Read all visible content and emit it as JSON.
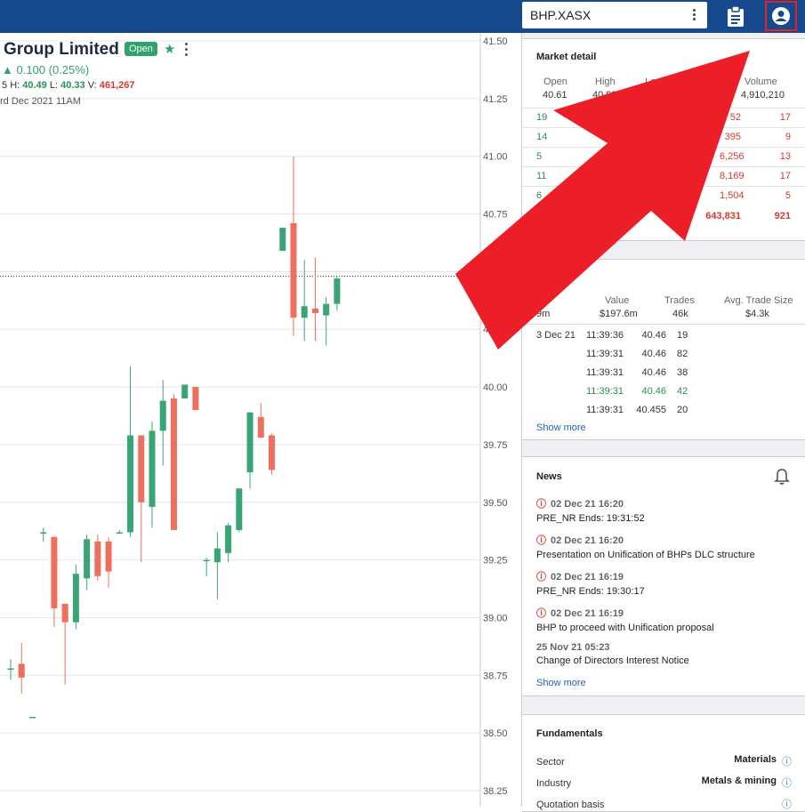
{
  "symbol_field": {
    "value": "BHP.XASX"
  },
  "stock": {
    "title": "Group Limited",
    "status": "Open",
    "change_text": "0.100 (0.25%)",
    "h_label": "H:",
    "high": "40.49",
    "l_label": "L:",
    "low": "40.33",
    "v_label": "V:",
    "volume": "461,267",
    "datetime": "rd Dec 2021 11AM",
    "prefix_digit": "5"
  },
  "chart_data": {
    "type": "candlestick",
    "y_ticks": [
      "41.50",
      "41.25",
      "41.00",
      "40.75",
      "40.50",
      "40.25",
      "40.00",
      "39.75",
      "39.50",
      "39.25",
      "39.00",
      "38.75",
      "38.50",
      "38.25"
    ],
    "ylim": [
      38.2,
      41.55
    ],
    "reference_line": 40.48,
    "candles": [
      {
        "o": 38.78,
        "h": 38.82,
        "l": 38.73,
        "c": 38.78
      },
      {
        "o": 38.8,
        "h": 38.89,
        "l": 38.67,
        "c": 38.74
      },
      {
        "o": 38.57,
        "h": 38.57,
        "l": 38.57,
        "c": 38.57
      },
      {
        "o": 39.37,
        "h": 39.39,
        "l": 39.33,
        "c": 39.37
      },
      {
        "o": 39.35,
        "h": 39.35,
        "l": 38.96,
        "c": 39.04
      },
      {
        "o": 39.06,
        "h": 39.06,
        "l": 38.71,
        "c": 38.98
      },
      {
        "o": 38.98,
        "h": 39.23,
        "l": 38.95,
        "c": 39.19
      },
      {
        "o": 39.17,
        "h": 39.36,
        "l": 39.12,
        "c": 39.34
      },
      {
        "o": 39.33,
        "h": 39.36,
        "l": 39.16,
        "c": 39.18
      },
      {
        "o": 39.33,
        "h": 39.35,
        "l": 39.13,
        "c": 39.2
      },
      {
        "o": 39.37,
        "h": 39.38,
        "l": 39.37,
        "c": 39.37
      },
      {
        "o": 39.37,
        "h": 40.09,
        "l": 39.35,
        "c": 39.79
      },
      {
        "o": 39.79,
        "h": 39.79,
        "l": 39.24,
        "c": 39.5
      },
      {
        "o": 39.48,
        "h": 39.85,
        "l": 39.39,
        "c": 39.81
      },
      {
        "o": 39.81,
        "h": 40.03,
        "l": 39.66,
        "c": 39.94
      },
      {
        "o": 39.95,
        "h": 39.97,
        "l": 39.38,
        "c": 39.38
      },
      {
        "o": 39.95,
        "h": 40.01,
        "l": 39.95,
        "c": 40.01
      },
      {
        "o": 40.0,
        "h": 40.0,
        "l": 39.9,
        "c": 39.9
      },
      {
        "o": 39.25,
        "h": 39.26,
        "l": 39.18,
        "c": 39.25
      },
      {
        "o": 39.24,
        "h": 39.37,
        "l": 39.08,
        "c": 39.3
      },
      {
        "o": 39.28,
        "h": 39.41,
        "l": 39.24,
        "c": 39.4
      },
      {
        "o": 39.38,
        "h": 39.56,
        "l": 39.37,
        "c": 39.56
      },
      {
        "o": 39.63,
        "h": 39.89,
        "l": 39.56,
        "c": 39.89
      },
      {
        "o": 39.87,
        "h": 39.93,
        "l": 39.78,
        "c": 39.78
      },
      {
        "o": 39.79,
        "h": 39.8,
        "l": 39.62,
        "c": 39.64
      },
      {
        "o": 40.59,
        "h": 40.69,
        "l": 40.59,
        "c": 40.69
      },
      {
        "o": 40.71,
        "h": 41.0,
        "l": 40.22,
        "c": 40.3
      },
      {
        "o": 40.3,
        "h": 40.55,
        "l": 40.2,
        "c": 40.35
      },
      {
        "o": 40.34,
        "h": 40.56,
        "l": 40.2,
        "c": 40.32
      },
      {
        "o": 40.31,
        "h": 40.39,
        "l": 40.18,
        "c": 40.36
      },
      {
        "o": 40.36,
        "h": 40.48,
        "l": 40.33,
        "c": 40.47
      }
    ]
  },
  "market_detail": {
    "title": "Market detail",
    "headers": {
      "open": "Open",
      "high": "High",
      "low": "Low",
      "volume": "Volume"
    },
    "values": {
      "open": "40.61",
      "high": "40.99",
      "volume": "4,910,210"
    },
    "rows": [
      {
        "left": "19",
        "right_vol": "52",
        "right_cnt": "17"
      },
      {
        "left": "14",
        "right_vol": "395",
        "right_cnt": "9"
      },
      {
        "left": "5",
        "right_vol": "6,256",
        "right_cnt": "13"
      },
      {
        "left": "11",
        "right_vol": "8,169",
        "right_cnt": "17"
      },
      {
        "left": "6",
        "right_vol": "1,504",
        "right_cnt": "5"
      }
    ],
    "total_vol": "643,831",
    "total_cnt": "921"
  },
  "activity": {
    "title": "ivity",
    "headers": {
      "col1": "me",
      "value": "Value",
      "trades": "Trades",
      "avg": "Avg. Trade Size"
    },
    "summary": {
      "col1": "9m",
      "value": "$197.6m",
      "trades": "46k",
      "avg": "$4.3k"
    },
    "trades": [
      {
        "date": "3 Dec 21",
        "time": "11:39:36",
        "price": "40.46",
        "qty": "19",
        "color": "dark"
      },
      {
        "date": "",
        "time": "11:39:31",
        "price": "40.46",
        "qty": "82",
        "color": "dark"
      },
      {
        "date": "",
        "time": "11:39:31",
        "price": "40.46",
        "qty": "38",
        "color": "dark"
      },
      {
        "date": "",
        "time": "11:39:31",
        "price": "40.46",
        "qty": "42",
        "color": "green"
      },
      {
        "date": "",
        "time": "11:39:31",
        "price": "40.455",
        "qty": "20",
        "color": "dark"
      }
    ],
    "show_more": "Show more"
  },
  "news": {
    "title": "News",
    "items": [
      {
        "date": "02 Dec 21 16:20",
        "headline": "PRE_NR Ends: 19:31:52",
        "alert": true
      },
      {
        "date": "02 Dec 21 16:20",
        "headline": "Presentation on Unification of BHPs DLC structure",
        "alert": true
      },
      {
        "date": "02 Dec 21 16:19",
        "headline": "PRE_NR Ends: 19:30:17",
        "alert": true
      },
      {
        "date": "02 Dec 21 16:19",
        "headline": "BHP to proceed with Unification proposal",
        "alert": true
      },
      {
        "date": "25 Nov 21 05:23",
        "headline": "Change of Directors Interest Notice",
        "alert": false
      }
    ],
    "show_more": "Show more"
  },
  "fundamentals": {
    "title": "Fundamentals",
    "rows": [
      {
        "label": "Sector",
        "value": "Materials"
      },
      {
        "label": "Industry",
        "value": "Metals & mining"
      },
      {
        "label": "Quotation basis",
        "value": ""
      }
    ]
  },
  "colors": {
    "up": "#3aa574",
    "down": "#ee6f5e",
    "accent": "#174a8c",
    "highlight": "#e32227"
  }
}
